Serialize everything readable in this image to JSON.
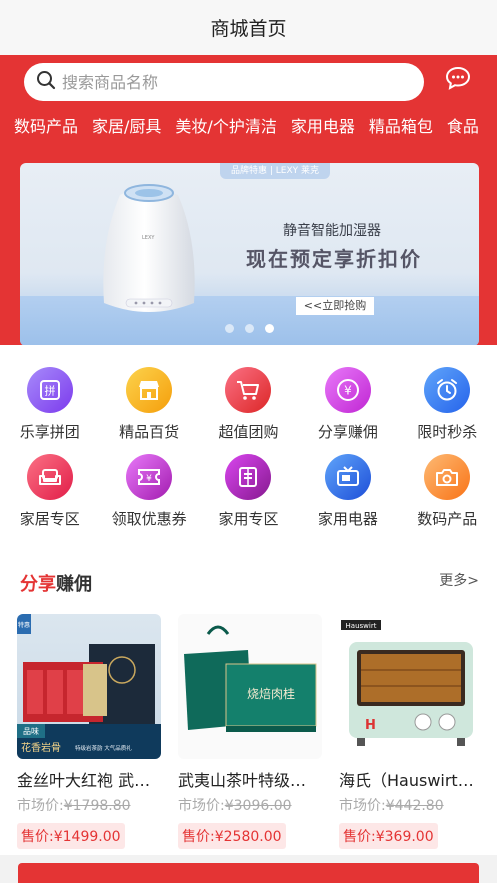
{
  "navbar": {
    "title": "商城首页"
  },
  "search": {
    "placeholder": "搜索商品名称"
  },
  "categories": [
    "数码产品",
    "家居/厨具",
    "美妆/个护清洁",
    "家用电器",
    "精品箱包",
    "食品"
  ],
  "banner": {
    "tag": "品牌特惠 | LEXY 莱克",
    "headline": "静音智能加湿器",
    "slogan": "现在预定享折扣价",
    "button": "<<立即抢购",
    "brand": "LEXY",
    "slides": 3,
    "active_slide": 3
  },
  "grid": [
    {
      "label": "乐享拼团",
      "icon": "group-buy-icon",
      "color": "#8b5cf6"
    },
    {
      "label": "精品百货",
      "icon": "store-icon",
      "color": "#f59e0b"
    },
    {
      "label": "超值团购",
      "icon": "cart-icon",
      "color": "#ef4444"
    },
    {
      "label": "分享赚佣",
      "icon": "yen-coin-icon",
      "color": "#c026d3"
    },
    {
      "label": "限时秒杀",
      "icon": "alarm-clock-icon",
      "color": "#3b82f6"
    },
    {
      "label": "家居专区",
      "icon": "sofa-icon",
      "color": "#f43f5e"
    },
    {
      "label": "领取优惠券",
      "icon": "coupon-icon",
      "color": "#c026d3"
    },
    {
      "label": "家用专区",
      "icon": "appliance-icon",
      "color": "#a21caf"
    },
    {
      "label": "家用电器",
      "icon": "tv-icon",
      "color": "#2563eb"
    },
    {
      "label": "数码产品",
      "icon": "camera-icon",
      "color": "#fb923c"
    }
  ],
  "share_section": {
    "title_red": "分享",
    "title_rest": "赚佣",
    "more": "更多>"
  },
  "products": [
    {
      "name": "金丝叶大红袍 武夷山岩茶礼盒",
      "market_label": "市场价:",
      "market_price": "¥1798.80",
      "price": "售价:¥1499.00",
      "img_texts": [
        "特惠",
        "品味",
        "花香岩骨",
        "特级岩茶韵 大气品质礼"
      ]
    },
    {
      "name": "武夷山茶叶特级肉桂礼盒",
      "market_label": "市场价:",
      "market_price": "¥3096.00",
      "price": "售价:¥2580.00",
      "img_texts": [
        "烧焙肉桂"
      ]
    },
    {
      "name": "海氏（Hauswirt）电烤箱",
      "market_label": "市场价:",
      "market_price": "¥442.80",
      "price": "售价:¥369.00",
      "img_texts": [
        "Hauswirt",
        "H"
      ]
    }
  ],
  "colors": {
    "primary": "#e43434",
    "price_bg": "#fde7e7"
  }
}
